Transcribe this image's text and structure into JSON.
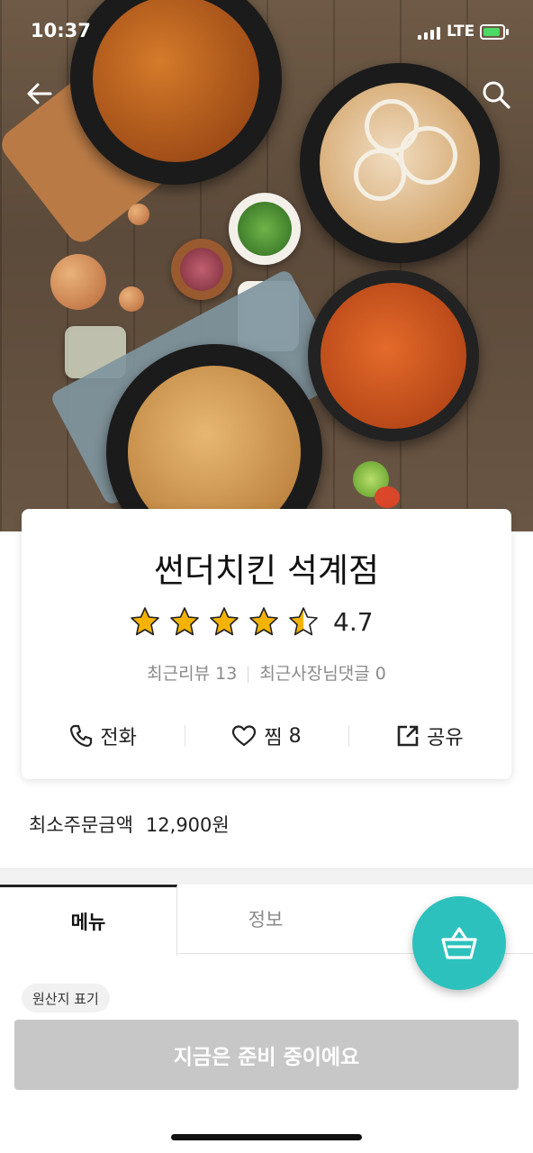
{
  "status_bar": {
    "time": "10:37",
    "network": "LTE"
  },
  "store": {
    "name": "썬더치킨 석계점",
    "rating": "4.7",
    "rating_stars": 4.5,
    "recent_reviews": "최근리뷰 13",
    "owner_comments": "최근사장님댓글 0"
  },
  "actions": {
    "call_label": "전화",
    "like_label": "찜",
    "like_count": "8",
    "share_label": "공유"
  },
  "min_order": {
    "label": "최소주문금액",
    "amount": "12,900원"
  },
  "tabs": [
    {
      "label": "메뉴"
    },
    {
      "label": "정보"
    }
  ],
  "origin_label": "원산지 표기",
  "status_button": "지금은 준비 중이에요",
  "colors": {
    "accent": "#2cc1bc",
    "star": "#f5b301",
    "disabled": "#c7c7c7"
  },
  "icons": {
    "back": "back-arrow-icon",
    "search": "search-icon",
    "phone": "phone-icon",
    "heart": "heart-icon",
    "share": "share-icon",
    "basket": "basket-icon"
  }
}
